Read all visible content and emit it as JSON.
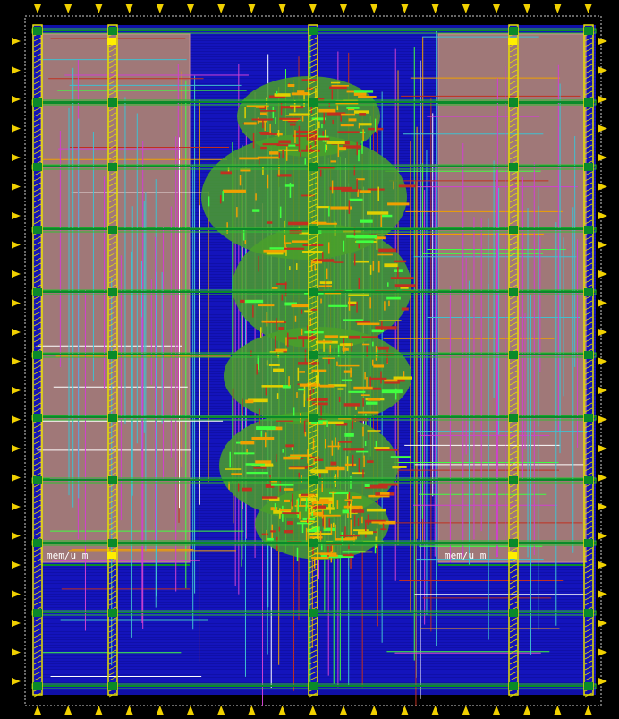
{
  "view": {
    "background": "#000000",
    "colors": {
      "core_fill": "#1010a8",
      "core_lines": "#2020ff",
      "macro": "#a07878",
      "macro_edge": "#c89090",
      "power_rail": "#e8e000",
      "strap_green": "#30c030",
      "via_green": "#0a8a2a",
      "route_red": "#c03020",
      "route_orange": "#f0a000",
      "route_magenta": "#d040d0",
      "route_cyan": "#40c0d0",
      "route_lime": "#40ff40",
      "pin_marker": "#f0d000",
      "boundary": "#d0d0d0"
    }
  },
  "macros": {
    "left_label": "mem/u_m",
    "right_label": "mem/u_m"
  },
  "pins": {
    "top_count": 19,
    "bottom_count": 19,
    "left_count": 23,
    "right_count": 23
  }
}
